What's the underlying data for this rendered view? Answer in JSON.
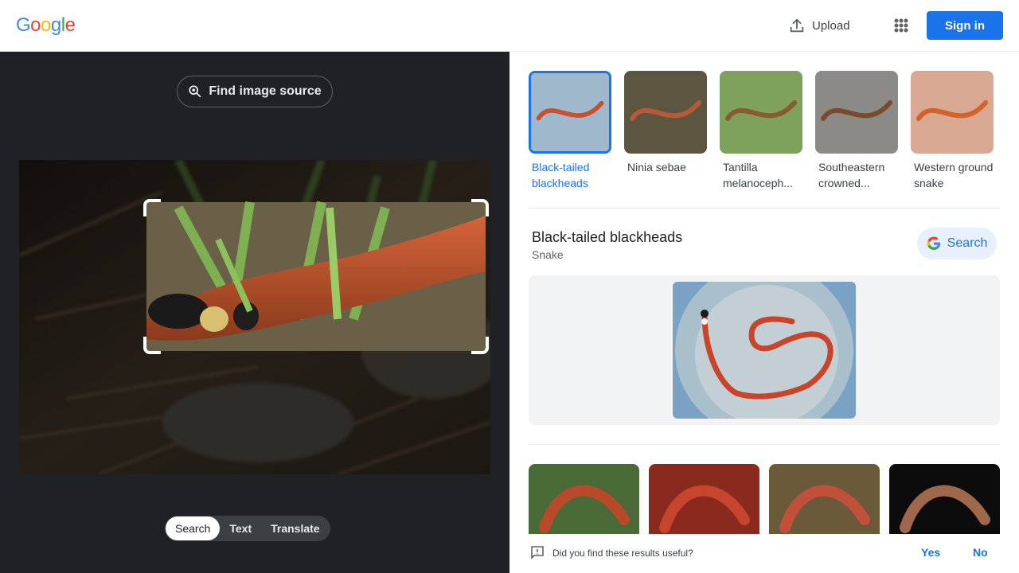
{
  "header": {
    "logo_letters": [
      "G",
      "o",
      "o",
      "g",
      "l",
      "e"
    ],
    "logo_colors": [
      "#4285f4",
      "#ea4335",
      "#fbbc05",
      "#4285f4",
      "#34a853",
      "#ea4335"
    ],
    "upload_label": "Upload",
    "signin_label": "Sign in"
  },
  "left_panel": {
    "find_source_label": "Find image source",
    "mode_tabs": [
      {
        "label": "Search",
        "active": true
      },
      {
        "label": "Text",
        "active": false
      },
      {
        "label": "Translate",
        "active": false
      }
    ]
  },
  "matches": [
    {
      "label": "Black-tailed blackheads",
      "selected": true,
      "bg": "#9fb8cc",
      "snake": "#c8502e"
    },
    {
      "label": "Ninia sebae",
      "selected": false,
      "bg": "#5c5640",
      "snake": "#b65a3c"
    },
    {
      "label": "Tantilla melanoceph...",
      "selected": false,
      "bg": "#7ea25c",
      "snake": "#8a5a32"
    },
    {
      "label": "Southeastern crowned...",
      "selected": false,
      "bg": "#8c8a86",
      "snake": "#7a4a2e"
    },
    {
      "label": "Western ground snake",
      "selected": false,
      "bg": "#d9a892",
      "snake": "#d4602a"
    }
  ],
  "entity": {
    "title": "Black-tailed blackheads",
    "subtitle": "Snake",
    "search_label": "Search"
  },
  "results": [
    {
      "bg": "#4a6a38",
      "snake": "#b84a2a"
    },
    {
      "bg": "#8a2a1e",
      "snake": "#c6452c"
    },
    {
      "bg": "#6a5a3a",
      "snake": "#c0503a"
    },
    {
      "bg": "#0c0c0c",
      "snake": "#a0684a"
    }
  ],
  "feedback": {
    "question": "Did you find these results useful?",
    "yes_label": "Yes",
    "no_label": "No"
  },
  "colors": {
    "accent": "#1a73e8",
    "dark_bg": "#202124"
  }
}
